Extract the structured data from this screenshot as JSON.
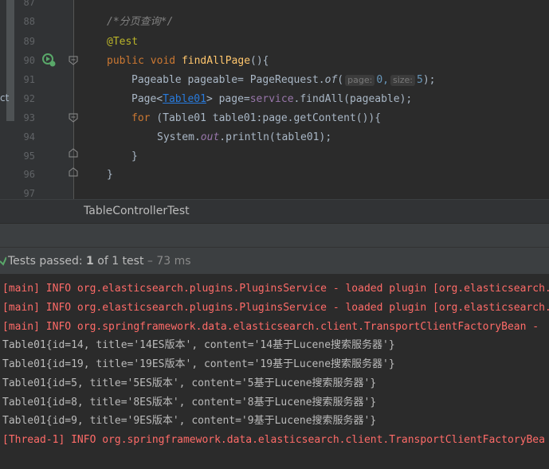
{
  "editor": {
    "left_clip_text": "ct",
    "lines": [
      {
        "no": "87"
      },
      {
        "no": "88",
        "comment": "/*分页查询*/"
      },
      {
        "no": "89",
        "annotation": "@Test"
      },
      {
        "no": "90",
        "kw1": "public",
        "kw2": "void",
        "fn": "findAllPage",
        "rest": "(){"
      },
      {
        "no": "91",
        "a": "Pageable pageable= PageRequest.",
        "b": "of",
        "c": "(",
        "hint1": "page:",
        "num1": "0,",
        "hint2": "size:",
        "num2": "5",
        "d": ");"
      },
      {
        "no": "92",
        "a": "Page<",
        "link": "Table01",
        "b": "> page=",
        "svc": "service",
        "c": ".findAll(pageable);"
      },
      {
        "no": "93",
        "kw": "for",
        "rest": " (Table01 table01:page.getContent()){"
      },
      {
        "no": "94",
        "a": "System.",
        "out": "out",
        "b": ".println(table01);"
      },
      {
        "no": "95",
        "rest": "}"
      },
      {
        "no": "96",
        "rest": "}"
      },
      {
        "no": "97"
      }
    ]
  },
  "breadcrumb": {
    "label": "TableControllerTest"
  },
  "status": {
    "prefix": "Tests passed: ",
    "count": "1",
    "mid": " of 1 test",
    "time": " – 73 ms"
  },
  "console": {
    "lines": [
      {
        "text": "[main] INFO org.elasticsearch.plugins.PluginsService - loaded plugin [org.elasticsearch.",
        "kind": "red"
      },
      {
        "text": "[main] INFO org.elasticsearch.plugins.PluginsService - loaded plugin [org.elasticsearch.",
        "kind": "red"
      },
      {
        "text": "[main] INFO org.springframework.data.elasticsearch.client.TransportClientFactoryBean - ",
        "kind": "red"
      },
      {
        "text": "Table01{id=14, title='14ES版本', content='14基于Lucene搜索服务器'}",
        "kind": "plain"
      },
      {
        "text": "Table01{id=19, title='19ES版本', content='19基于Lucene搜索服务器'}",
        "kind": "plain"
      },
      {
        "text": "Table01{id=5, title='5ES版本', content='5基于Lucene搜索服务器'}",
        "kind": "plain"
      },
      {
        "text": "Table01{id=8, title='8ES版本', content='8基于Lucene搜索服务器'}",
        "kind": "plain"
      },
      {
        "text": "Table01{id=9, title='9ES版本', content='9基于Lucene搜索服务器'}",
        "kind": "plain"
      },
      {
        "text": "[Thread-1] INFO org.springframework.data.elasticsearch.client.TransportClientFactoryBea",
        "kind": "red"
      }
    ]
  },
  "icons": {
    "run": "run-gutter-icon",
    "fold": "fold-marker-icon",
    "check": "tests-passed-icon"
  },
  "colors": {
    "keyword": "#cc7832",
    "function": "#ffc66d",
    "comment": "#808080",
    "annotation": "#bbb529",
    "number": "#6897bb",
    "error_log": "#ff6b68"
  }
}
